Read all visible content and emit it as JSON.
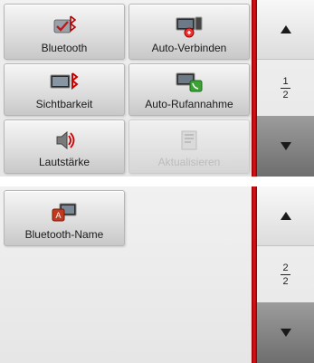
{
  "screen1": {
    "tiles": [
      {
        "label": "Bluetooth",
        "icon": "bluetooth-settings-icon"
      },
      {
        "label": "Auto-Verbinden",
        "icon": "auto-connect-icon"
      },
      {
        "label": "Sichtbarkeit",
        "icon": "visibility-icon"
      },
      {
        "label": "Auto-Rufannahme",
        "icon": "auto-answer-icon"
      },
      {
        "label": "Lautstärke",
        "icon": "volume-icon"
      },
      {
        "label": "Aktualisieren",
        "icon": "refresh-icon",
        "disabled": true
      }
    ],
    "page": {
      "current": "1",
      "total": "2"
    }
  },
  "screen2": {
    "tiles": [
      {
        "label": "Bluetooth-Name",
        "icon": "bluetooth-name-icon"
      }
    ],
    "page": {
      "current": "2",
      "total": "2"
    }
  },
  "colors": {
    "accent_red": "#e0141b",
    "nav_dark": "#7a7a7a"
  },
  "icons": {
    "up": "arrow-up-icon",
    "down": "arrow-down-icon"
  }
}
